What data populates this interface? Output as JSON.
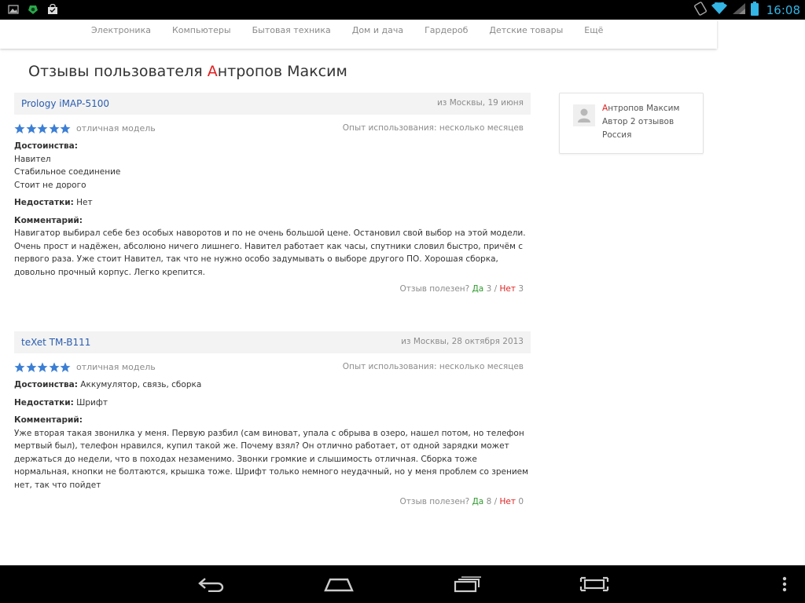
{
  "status_bar": {
    "time": "16:08",
    "left_icons": [
      "gallery-icon",
      "android-app-icon",
      "store-bag-icon"
    ],
    "right_icons": [
      "rotate-lock-icon",
      "wifi-icon",
      "cell-signal-icon",
      "battery-icon"
    ]
  },
  "nav": {
    "items": [
      "Электроника",
      "Компьютеры",
      "Бытовая техника",
      "Дом и дача",
      "Гардероб",
      "Детские товары",
      "Ещё"
    ]
  },
  "page": {
    "title_prefix": "Отзывы пользователя ",
    "title_name_first": "А",
    "title_name_rest": "нтропов Максим"
  },
  "author": {
    "name_first": "А",
    "name_rest": "нтропов Максим",
    "reviews_count": "Автор 2 отзывов",
    "country": "Россия"
  },
  "reviews": [
    {
      "product": "Prology iMAP-5100",
      "meta": "из Москвы, 19 июня",
      "rating": 5,
      "rating_label": "отличная модель",
      "experience": "Опыт использования: несколько месяцев",
      "pros_label": "Достоинства:",
      "pros": [
        "Навител",
        "Стабильное соединение",
        "Стоит не дорого"
      ],
      "cons_label": "Недостатки:",
      "cons": "Нет",
      "comment_label": "Комментарий:",
      "comment": "Навигатор выбирал себе без особых наворотов и по не очень большой цене. Остановил свой выбор на этой модели. Очень прост и надёжен, абсолюно ничего лишнего. Навител работает как часы, спутники словил быстро, причём с первого раза. Уже стоит Навител, так что не нужно особо задумывать о выборе другого ПО. Хорошая сборка, довольно прочный корпус. Легко крепится.",
      "useful_label": "Отзыв полезен?",
      "yes_label": "Да",
      "yes_count": "3",
      "separator": "/",
      "no_label": "Нет",
      "no_count": "3"
    },
    {
      "product": "teXet TM-B111",
      "meta": "из Москвы, 28 октября 2013",
      "rating": 5,
      "rating_label": "отличная модель",
      "experience": "Опыт использования: несколько месяцев",
      "pros_label": "Достоинства:",
      "pros_inline": "Аккумулятор, связь, сборка",
      "cons_label": "Недостатки:",
      "cons": "Шрифт",
      "comment_label": "Комментарий:",
      "comment": "Уже вторая такая звонилка у меня. Первую разбил (сам виноват, упала с обрыва в озеро, нашел потом, но телефон мертвый был), телефон нравился, купил такой же. Почему взял? Он отлично работает, от одной зарядки может держаться до недели, что в походах незаменимо. Звонки громкие и слышимость отличная. Сборка тоже нормальная, кнопки не болтаются, крышка тоже. Шрифт только немного неудачный, но у меня проблем со зрением нет, так что пойдет",
      "useful_label": "Отзыв полезен?",
      "yes_label": "Да",
      "yes_count": "8",
      "separator": "/",
      "no_label": "Нет",
      "no_count": "0"
    }
  ],
  "navbar": {
    "buttons": [
      "back-icon",
      "home-icon",
      "recent-apps-icon",
      "fullscreen-icon",
      "menu-icon"
    ]
  },
  "colors": {
    "link_blue": "#2a5db0",
    "accent_red": "#e02020",
    "yes_green": "#2e9a2e",
    "star_blue": "#3b7fd4",
    "status_time": "#33b5e5"
  }
}
